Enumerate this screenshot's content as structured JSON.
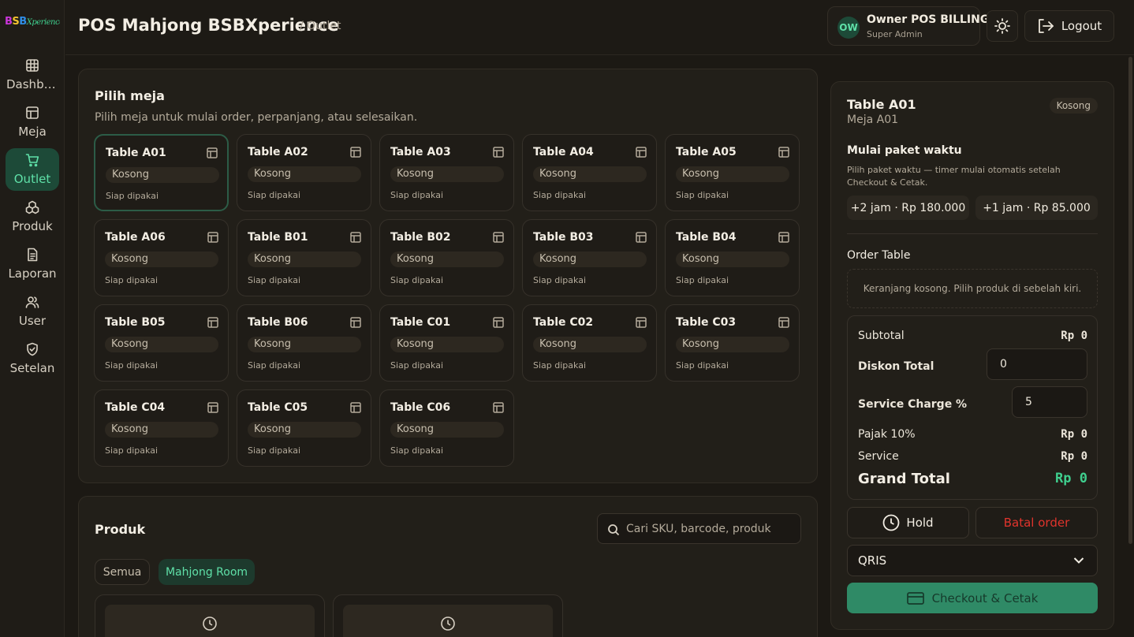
{
  "brand": {
    "logo_b1": "B",
    "logo_s": "S",
    "logo_b2": "B",
    "logo_rest": "Xperience"
  },
  "sidebar": {
    "items": [
      {
        "label": "Dashboard",
        "icon": "grid-icon"
      },
      {
        "label": "Meja",
        "icon": "table-icon"
      },
      {
        "label": "Outlet",
        "icon": "cart-icon",
        "active": true
      },
      {
        "label": "Produk",
        "icon": "boxes-icon"
      },
      {
        "label": "Laporan",
        "icon": "report-icon"
      },
      {
        "label": "User",
        "icon": "users-icon"
      },
      {
        "label": "Setelan",
        "icon": "shield-icon"
      }
    ]
  },
  "header": {
    "title": "POS Mahjong BSBXperience",
    "breadcrumb": "/ Outlet",
    "user": {
      "initials": "OW",
      "name": "Owner POS BILLING",
      "role": "Super Admin"
    },
    "logout_label": "Logout"
  },
  "tables": {
    "title": "Pilih meja",
    "subtitle": "Pilih meja untuk mulai order, perpanjang, atau selesaikan.",
    "items": [
      {
        "name": "Table A01",
        "status": "Kosong",
        "note": "Siap dipakai",
        "selected": true
      },
      {
        "name": "Table A02",
        "status": "Kosong",
        "note": "Siap dipakai"
      },
      {
        "name": "Table A03",
        "status": "Kosong",
        "note": "Siap dipakai"
      },
      {
        "name": "Table A04",
        "status": "Kosong",
        "note": "Siap dipakai"
      },
      {
        "name": "Table A05",
        "status": "Kosong",
        "note": "Siap dipakai"
      },
      {
        "name": "Table A06",
        "status": "Kosong",
        "note": "Siap dipakai"
      },
      {
        "name": "Table B01",
        "status": "Kosong",
        "note": "Siap dipakai"
      },
      {
        "name": "Table B02",
        "status": "Kosong",
        "note": "Siap dipakai"
      },
      {
        "name": "Table B03",
        "status": "Kosong",
        "note": "Siap dipakai"
      },
      {
        "name": "Table B04",
        "status": "Kosong",
        "note": "Siap dipakai"
      },
      {
        "name": "Table B05",
        "status": "Kosong",
        "note": "Siap dipakai"
      },
      {
        "name": "Table B06",
        "status": "Kosong",
        "note": "Siap dipakai"
      },
      {
        "name": "Table C01",
        "status": "Kosong",
        "note": "Siap dipakai"
      },
      {
        "name": "Table C02",
        "status": "Kosong",
        "note": "Siap dipakai"
      },
      {
        "name": "Table C03",
        "status": "Kosong",
        "note": "Siap dipakai"
      },
      {
        "name": "Table C04",
        "status": "Kosong",
        "note": "Siap dipakai"
      },
      {
        "name": "Table C05",
        "status": "Kosong",
        "note": "Siap dipakai"
      },
      {
        "name": "Table C06",
        "status": "Kosong",
        "note": "Siap dipakai"
      }
    ]
  },
  "products": {
    "title": "Produk",
    "search_placeholder": "Cari SKU, barcode, produk",
    "categories": [
      {
        "label": "Semua"
      },
      {
        "label": "Mahjong Room",
        "active": true
      }
    ],
    "items": [
      {
        "icon": "clock-icon"
      },
      {
        "icon": "clock-icon"
      }
    ]
  },
  "order": {
    "table_title": "Table A01",
    "table_sub": "Meja A01",
    "status": "Kosong",
    "package_title": "Mulai paket waktu",
    "package_hint": "Pilih paket waktu — timer mulai otomatis setelah Checkout & Cetak.",
    "packages": [
      "+2 jam · Rp 180.000",
      "+1 jam · Rp 85.000"
    ],
    "order_title": "Order Table",
    "cart_empty": "Keranjang kosong. Pilih produk di sebelah kiri.",
    "subtotal_label": "Subtotal",
    "subtotal_value": "Rp 0",
    "discount_label": "Diskon Total",
    "discount_value": "0",
    "service_pct_label": "Service Charge %",
    "service_pct_value": "5",
    "tax_label": "Pajak 10%",
    "tax_value": "Rp 0",
    "service_label": "Service",
    "service_value": "Rp 0",
    "grand_label": "Grand Total",
    "grand_value": "Rp 0",
    "hold_label": "Hold",
    "cancel_label": "Batal order",
    "payment_method": "QRIS",
    "checkout_label": "Checkout & Cetak"
  },
  "colors": {
    "accent": "#3fcf8e",
    "accent_bg": "#1d4a38",
    "danger": "#e0342c",
    "checkout": "#2f8a66"
  }
}
